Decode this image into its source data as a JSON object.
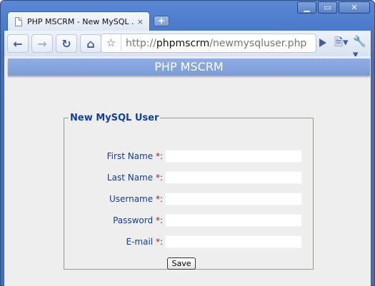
{
  "browser": {
    "tab_title": "PHP MSCRM - New MySQL ...",
    "tab_close": "×",
    "new_tab": "+",
    "url_scheme": "http://",
    "url_host": "phpmscrm",
    "url_path": "/newmysqluser.php",
    "window_buttons": {
      "minimize": "▁",
      "maximize": "▭",
      "close": "✕"
    },
    "icons": [
      "page-icon",
      "back-icon",
      "forward-icon",
      "reload-icon",
      "home-icon",
      "star-icon",
      "go-icon",
      "page-menu-icon",
      "wrench-icon"
    ]
  },
  "page": {
    "banner": "PHP MSCRM",
    "form_legend": "New MySQL User",
    "fields": [
      {
        "label": "First Name",
        "required_mark": "*",
        "suffix": ":",
        "value": ""
      },
      {
        "label": "Last Name",
        "required_mark": "*",
        "suffix": ":",
        "value": ""
      },
      {
        "label": "Username",
        "required_mark": "*",
        "suffix": ":",
        "value": ""
      },
      {
        "label": "Password",
        "required_mark": "*",
        "suffix": ":",
        "value": ""
      },
      {
        "label": "E-mail",
        "required_mark": "*",
        "suffix": ":",
        "value": ""
      }
    ],
    "save_label": "Save"
  },
  "colors": {
    "frame": "#4a7ac9",
    "banner": "#8aa9e0",
    "label": "#1a3b8a",
    "required": "#d40000",
    "background": "#eeeeee"
  }
}
